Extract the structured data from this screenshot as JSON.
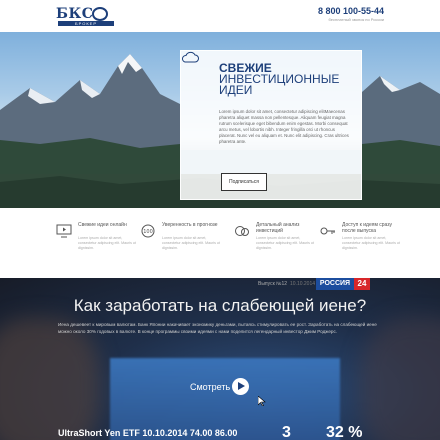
{
  "header": {
    "logo_text": "БКС",
    "logo_sub": "БРОКЕР",
    "phone": "8 800 100-55-44",
    "phone_note": "бесплатный звонок по России"
  },
  "hero": {
    "title_line1": "Свежие",
    "title_line2": "инвестиционные",
    "title_line3": "идеи",
    "text": "Lorem ipsum dolor sit amet, consectetur adipiscing elitMaecenas pharetra aliquet massa non pellentesque. Aliquam feugiat magna rutrum scelerisque eget bibendum enim egestas. Morbi consequat arcu metus, vel lobortis nibh. Integer fringilla orci ut rhoncus placerat. Nunc vel eu aliquam et. Nunc elit adipiscing. Cras ultrices pharetra ante.",
    "button_label": "Подписаться"
  },
  "features": [
    {
      "icon": "tv-icon",
      "title": "Свежие идеи онлайн",
      "text": "Lorem ipsum dolor sit amet, consectetur adipiscing elit. Mauris ut dignissim."
    },
    {
      "icon": "badge-100-icon",
      "title": "Уверенность в прогнозе",
      "text": "Lorem ipsum dolor sit amet, consectetur adipiscing elit. Mauris ut dignissim."
    },
    {
      "icon": "analysis-icon",
      "title": "Детальный анализ инвестиций",
      "text": "Lorem ipsum dolor sit amet, consectetur adipiscing elit. Mauris ut dignissim."
    },
    {
      "icon": "key-icon",
      "title": "Доступ к идеям сразу после выпуска",
      "text": "Lorem ipsum dolor sit amet, consectetur adipiscing elit. Mauris ut dignissim."
    }
  ],
  "video": {
    "issue": "Выпуск №12",
    "date": "10.10.2014",
    "channel_name": "РОССИЯ",
    "channel_number": "24",
    "title": "Как заработать на слабеющей иене?",
    "description": "Иена дешевеет к мировым валютам. Банк Японии накачивает экономику деньгами, пытаясь стимулировать ее рост. Заработать на слабеющей иене можно около 30% годовых в валюте. В конце программы своими идеями с нами поделится легендарный инвестор Джим Роджерс.",
    "watch_label": "Смотреть",
    "ticker": "UltraShort Yen ETF   10.10.2014   74.00   86.00",
    "ticker_big": "3",
    "ticker_pct": "32 %"
  },
  "colors": {
    "brand": "#1d3f7a",
    "channel_blue": "#1c4d9e",
    "channel_red": "#d8262a"
  }
}
